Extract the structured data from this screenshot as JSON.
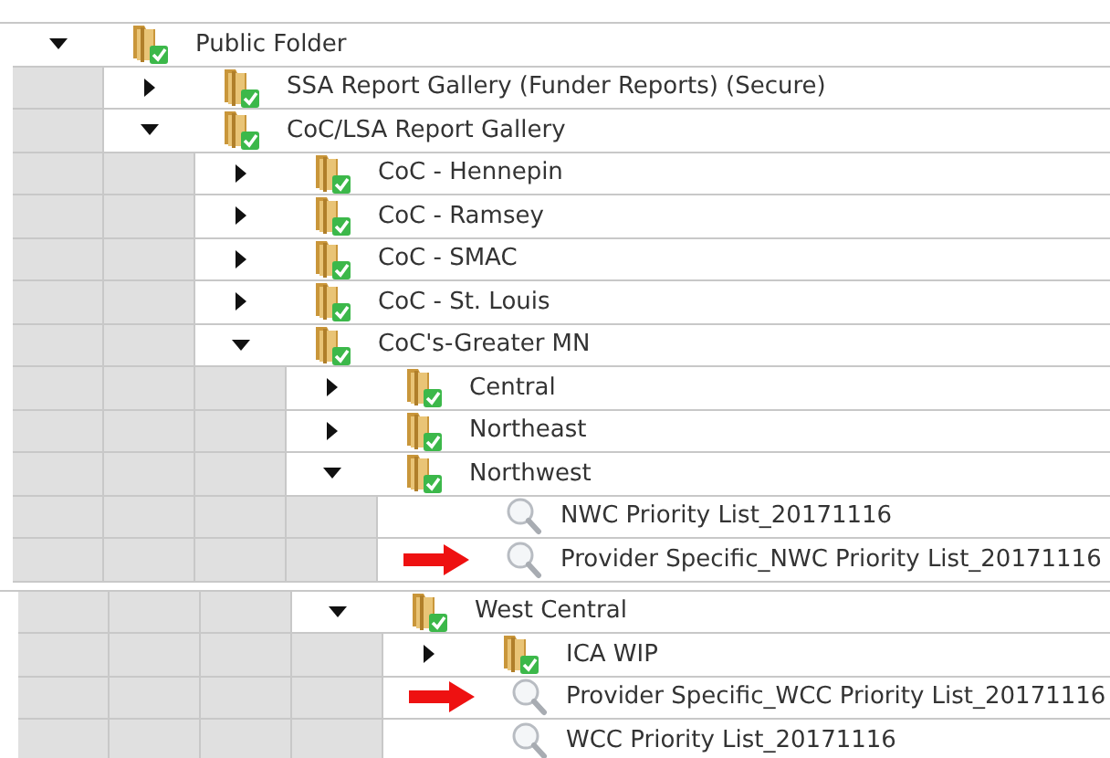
{
  "fragments": [
    {
      "items": [
        {
          "label": "Public Folder",
          "kind": "folder",
          "expanded": true,
          "children": [
            {
              "label": "SSA Report Gallery (Funder Reports) (Secure)",
              "kind": "folder",
              "expanded": false
            },
            {
              "label": "CoC/LSA Report Gallery",
              "kind": "folder",
              "expanded": true,
              "children": [
                {
                  "label": "CoC - Hennepin",
                  "kind": "folder",
                  "expanded": false
                },
                {
                  "label": "CoC - Ramsey",
                  "kind": "folder",
                  "expanded": false
                },
                {
                  "label": "CoC - SMAC",
                  "kind": "folder",
                  "expanded": false
                },
                {
                  "label": "CoC - St. Louis",
                  "kind": "folder",
                  "expanded": false
                },
                {
                  "label": "CoC's-Greater MN",
                  "kind": "folder",
                  "expanded": true,
                  "children": [
                    {
                      "label": "Central",
                      "kind": "folder",
                      "expanded": false
                    },
                    {
                      "label": "Northeast",
                      "kind": "folder",
                      "expanded": false
                    },
                    {
                      "label": "Northwest",
                      "kind": "folder",
                      "expanded": true,
                      "children": [
                        {
                          "label": "NWC Priority List_20171116",
                          "kind": "report",
                          "flagged": false
                        },
                        {
                          "label": "Provider Specific_NWC Priority List_20171116",
                          "kind": "report",
                          "flagged": true
                        }
                      ]
                    }
                  ]
                }
              ]
            }
          ]
        }
      ]
    },
    {
      "items": [
        {
          "label": "West Central",
          "kind": "folder",
          "expanded": true,
          "children": [
            {
              "label": "ICA WIP",
              "kind": "folder",
              "expanded": false
            },
            {
              "label": "Provider Specific_WCC Priority List_20171116",
              "kind": "report",
              "flagged": true
            },
            {
              "label": "WCC Priority List_20171116",
              "kind": "report",
              "flagged": false
            }
          ]
        }
      ]
    }
  ]
}
